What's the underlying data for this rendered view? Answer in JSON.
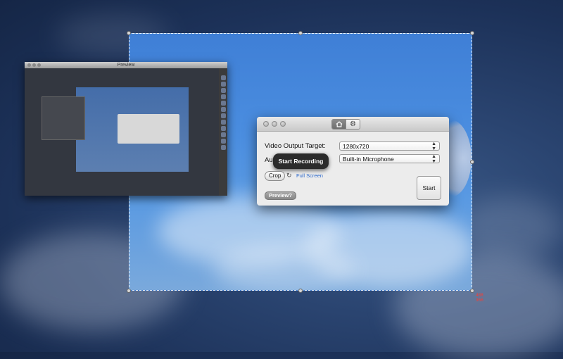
{
  "preview_window": {
    "title": "Preview"
  },
  "app": {
    "tabs": [
      {
        "name": "home",
        "icon": "house-icon",
        "active": true
      },
      {
        "name": "settings",
        "icon": "gear-icon",
        "active": false
      }
    ],
    "video_output_label": "Video Output Target:",
    "video_output_value": "1280x720",
    "audio_label": "Au",
    "audio_value": "Built-in Microphone",
    "tooltip": "Start Recording",
    "crop_label": "Crop",
    "fullscreen_label": "Full Screen",
    "preview_label": "Preview?",
    "start_label": "Start",
    "accent_color": "#2a67c9"
  },
  "selection": {
    "dimension_readout": [
      "488",
      "366"
    ]
  }
}
